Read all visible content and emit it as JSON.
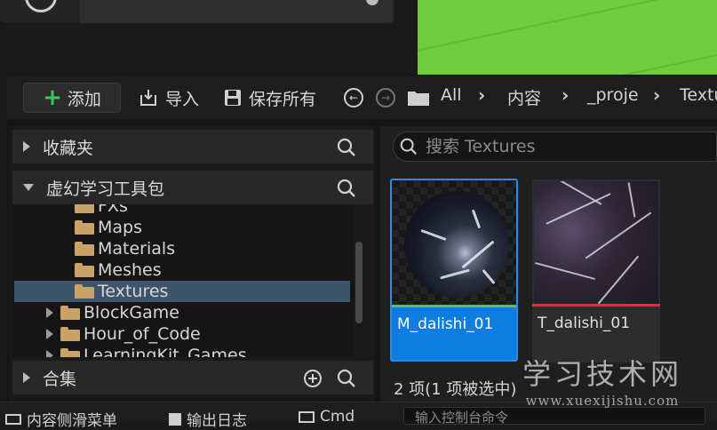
{
  "toolbar": {
    "add_label": "添加",
    "import_label": "导入",
    "save_all_label": "保存所有"
  },
  "breadcrumb": [
    "All",
    "内容",
    "_proje",
    "Textu"
  ],
  "sidebar": {
    "favorites_label": "收藏夹",
    "project_label": "虚幻学习工具包",
    "collections_label": "合集",
    "tree": [
      {
        "label": "FXs",
        "level": 1,
        "selected": false
      },
      {
        "label": "Maps",
        "level": 1,
        "selected": false
      },
      {
        "label": "Materials",
        "level": 1,
        "selected": false
      },
      {
        "label": "Meshes",
        "level": 1,
        "selected": false
      },
      {
        "label": "Textures",
        "level": 1,
        "selected": true
      },
      {
        "label": "BlockGame",
        "level": 0,
        "selected": false
      },
      {
        "label": "Hour_of_Code",
        "level": 0,
        "selected": false
      },
      {
        "label": "LearningKit_Games",
        "level": 0,
        "selected": false
      }
    ]
  },
  "search": {
    "placeholder": "搜索 Textures"
  },
  "assets": [
    {
      "name": "M_dalishi_01",
      "type_color": "#5ec542",
      "selected": true
    },
    {
      "name": "T_dalishi_01",
      "type_color": "#c83a3a",
      "selected": false
    }
  ],
  "status": "2 项(1 项被选中)",
  "bottom_bar": {
    "drawer_label": "内容侧滑菜单",
    "output_log_label": "输出日志",
    "cmd_label": "Cmd",
    "console_placeholder": "输入控制台命令"
  },
  "watermark": {
    "title": "学习技术网",
    "url": "www.xuexijishu.com"
  },
  "colors": {
    "accent": "#0d7de0",
    "selection": "#3e546d",
    "folder": "#c9a46a",
    "viewport": "#6fcc3c"
  }
}
